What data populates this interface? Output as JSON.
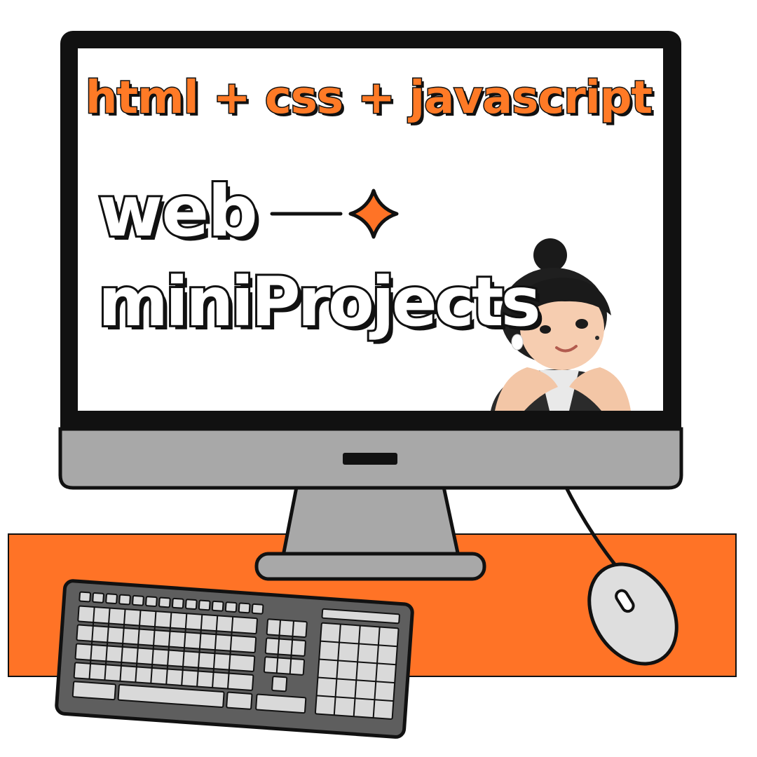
{
  "screen": {
    "headline": "html + css + javascript",
    "title_line1": "web",
    "title_line2": "miniProjects"
  },
  "illustration": {
    "objects": [
      "monitor",
      "keyboard",
      "mouse",
      "desk-mat",
      "avatar-icon",
      "sparkle-icon"
    ]
  },
  "colors": {
    "accent": "#ff7326",
    "outline": "#111111",
    "monitor_gray": "#a8a8a8",
    "keyboard_gray": "#5e5e5e",
    "key_light": "#d9d9d9",
    "mouse_light": "#dedede"
  }
}
